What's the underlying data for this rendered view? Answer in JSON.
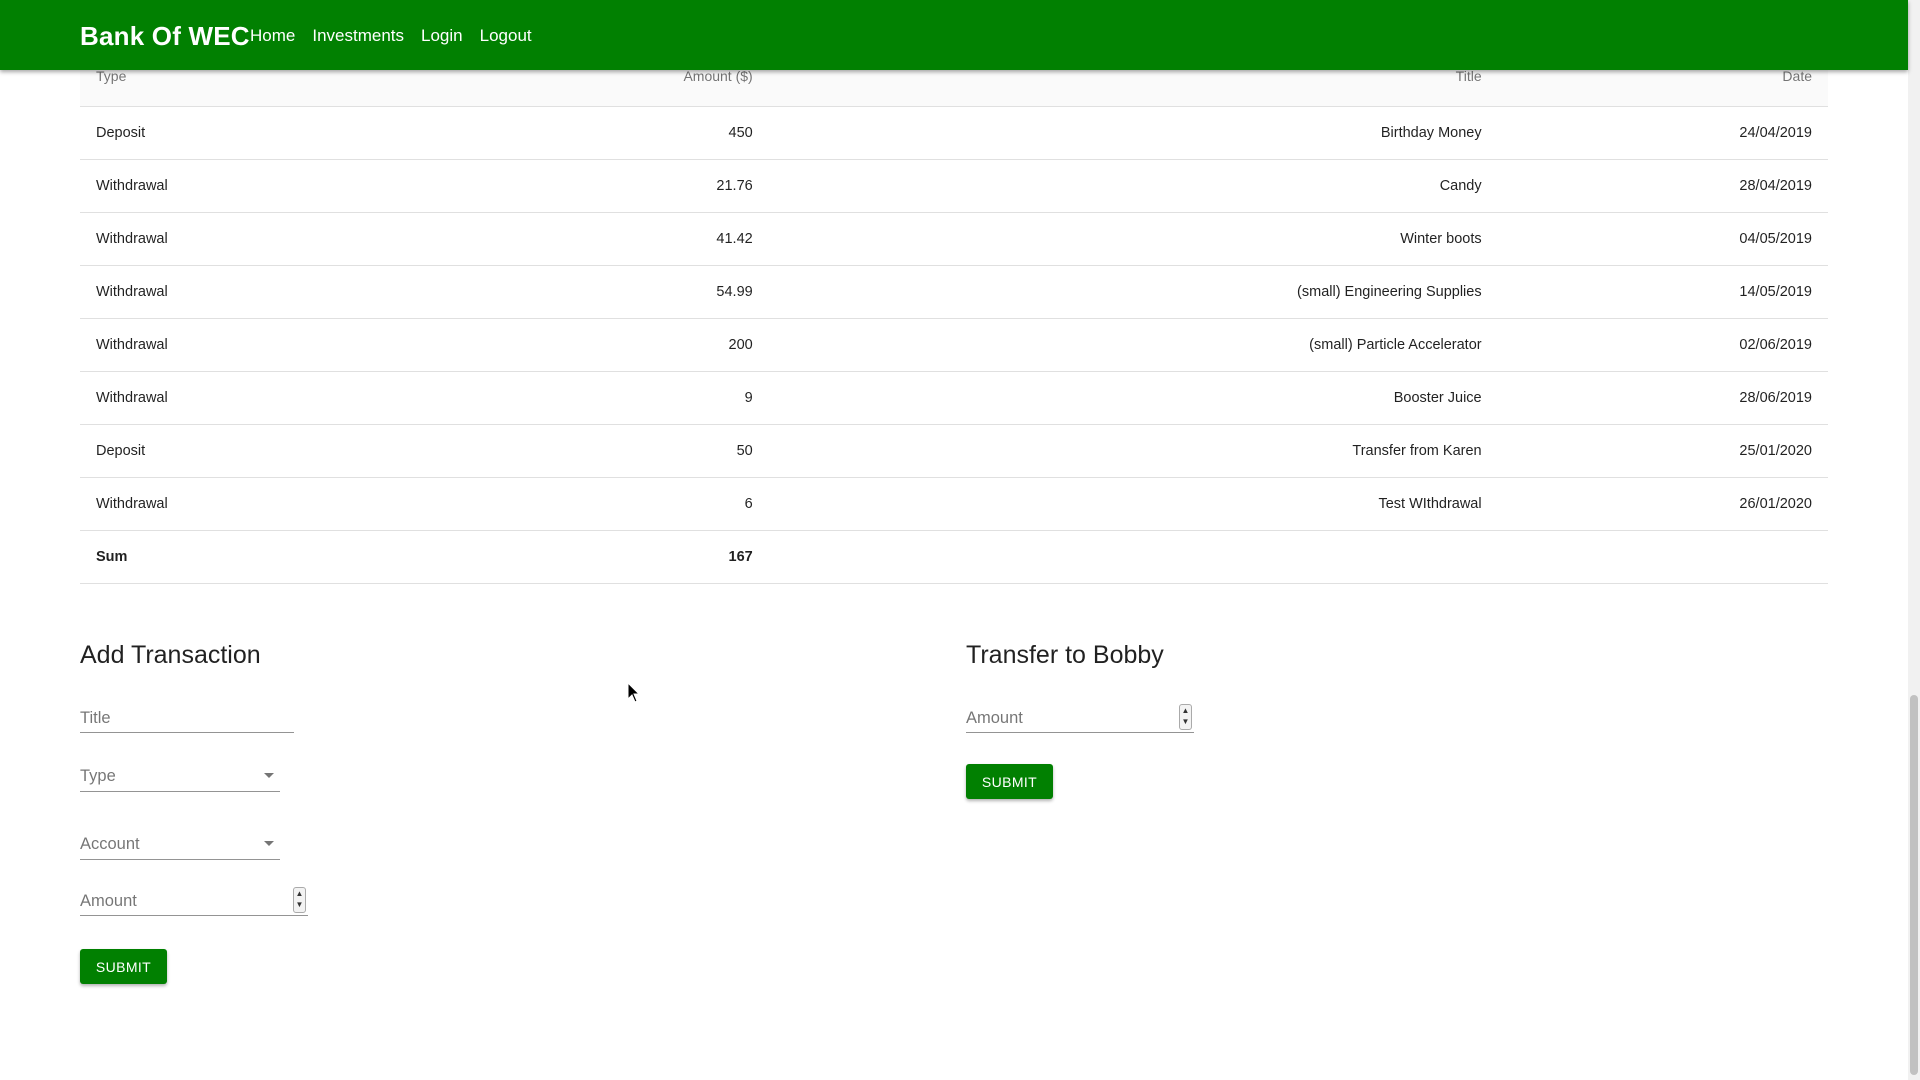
{
  "header": {
    "brand": "Bank Of WEC",
    "nav": [
      "Home",
      "Investments",
      "Login",
      "Logout"
    ]
  },
  "table": {
    "columns": [
      "Type",
      "Amount ($)",
      "Title",
      "Date"
    ],
    "rows": [
      {
        "type": "Deposit",
        "amount": "450",
        "title": "Birthday Money",
        "date": "24/04/2019"
      },
      {
        "type": "Withdrawal",
        "amount": "21.76",
        "title": "Candy",
        "date": "28/04/2019"
      },
      {
        "type": "Withdrawal",
        "amount": "41.42",
        "title": "Winter boots",
        "date": "04/05/2019"
      },
      {
        "type": "Withdrawal",
        "amount": "54.99",
        "title": "(small) Engineering Supplies",
        "date": "14/05/2019"
      },
      {
        "type": "Withdrawal",
        "amount": "200",
        "title": "(small) Particle Accelerator",
        "date": "02/06/2019"
      },
      {
        "type": "Withdrawal",
        "amount": "9",
        "title": "Booster Juice",
        "date": "28/06/2019"
      },
      {
        "type": "Deposit",
        "amount": "50",
        "title": "Transfer from Karen",
        "date": "25/01/2020"
      },
      {
        "type": "Withdrawal",
        "amount": "6",
        "title": "Test WIthdrawal",
        "date": "26/01/2020"
      }
    ],
    "sum": {
      "label": "Sum",
      "amount": "167"
    }
  },
  "add_transaction": {
    "title": "Add Transaction",
    "title_placeholder": "Title",
    "type_label": "Type",
    "account_label": "Account",
    "amount_placeholder": "Amount",
    "submit": "SUBMIT"
  },
  "transfer": {
    "title": "Transfer to Bobby",
    "amount_placeholder": "Amount",
    "submit": "SUBMIT"
  },
  "colors": {
    "brand_green": "#018001"
  }
}
